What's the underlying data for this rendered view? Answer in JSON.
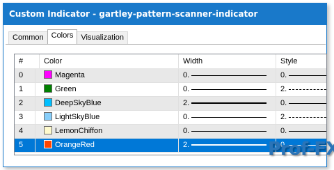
{
  "window": {
    "title": "Custom Indicator - gartley-pattern-scanner-indicator",
    "title_bg": "#1979ca"
  },
  "tabs": [
    {
      "label": "Common",
      "active": false
    },
    {
      "label": "Colors",
      "active": true
    },
    {
      "label": "Visualization",
      "active": false
    }
  ],
  "grid": {
    "columns": [
      "#",
      "Color",
      "Width",
      "Style"
    ],
    "rows": [
      {
        "index": "0",
        "color_name": "Magenta",
        "swatch": "#ff00ff",
        "width": "0.",
        "style": "0.",
        "line": "solid",
        "selected": false
      },
      {
        "index": "1",
        "color_name": "Green",
        "swatch": "#008000",
        "width": "0.",
        "style": "2.",
        "line": "dash",
        "selected": false
      },
      {
        "index": "2",
        "color_name": "DeepSkyBlue",
        "swatch": "#00bfff",
        "width": "2.",
        "style": "0.",
        "line": "solid-thick",
        "selected": false
      },
      {
        "index": "3",
        "color_name": "LightSkyBlue",
        "swatch": "#87cefa",
        "width": "0.",
        "style": "2.",
        "line": "dash",
        "selected": false
      },
      {
        "index": "4",
        "color_name": "LemonChiffon",
        "swatch": "#fffacd",
        "width": "0.",
        "style": "0.",
        "line": "solid",
        "selected": false
      },
      {
        "index": "5",
        "color_name": "OrangeRed",
        "swatch": "#ff4500",
        "width": "2.",
        "style": "0.",
        "line": "solid-thick",
        "selected": true
      }
    ],
    "selected_bg": "#0078d7",
    "alt_bg": "#e8e8e8"
  },
  "watermark": {
    "text": "Prof-FX",
    "color": "#2a74b8"
  }
}
